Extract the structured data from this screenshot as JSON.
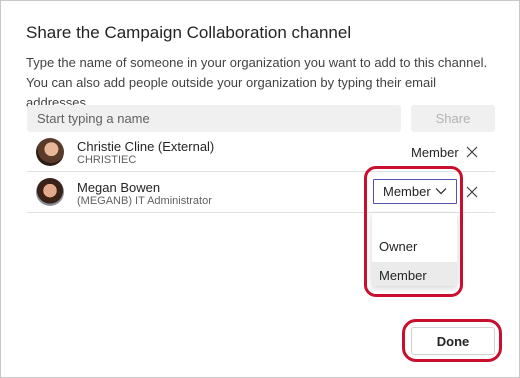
{
  "dialog": {
    "title": "Share the Campaign Collaboration channel",
    "description": "Type the name of someone in your organization you want to add to this channel. You can also add people outside your organization by typing their email addresses."
  },
  "search": {
    "placeholder": "Start typing a name",
    "share_label": "Share"
  },
  "members": [
    {
      "name": "Christie Cline (External)",
      "subtitle": "CHRISTIEC",
      "role": "Member"
    },
    {
      "name": "Megan Bowen",
      "subtitle": "(MEGANB) IT Administrator",
      "role": "Member"
    }
  ],
  "role_menu": {
    "options": [
      "Owner",
      "Member"
    ],
    "selected": "Member"
  },
  "footer": {
    "done_label": "Done"
  },
  "colors": {
    "highlight": "#c8102e",
    "focus_border": "#4f52b2"
  }
}
